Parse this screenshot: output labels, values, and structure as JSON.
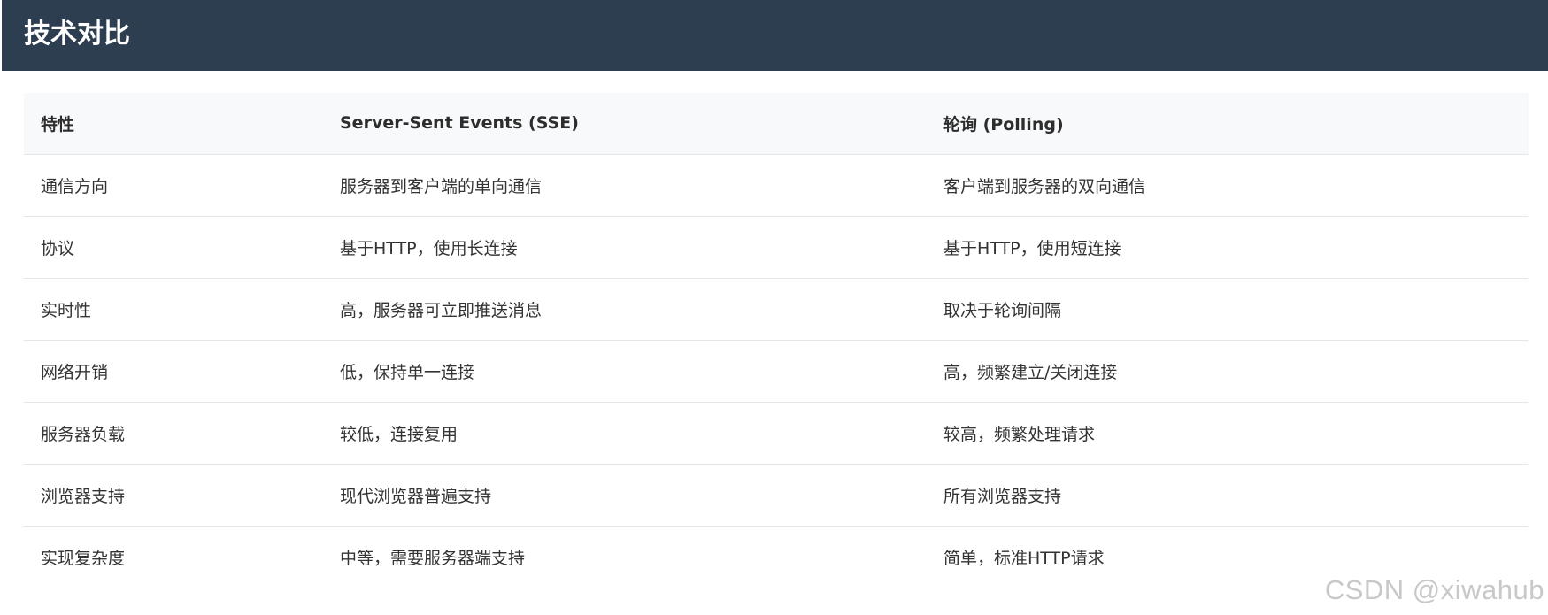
{
  "header": {
    "title": "技术对比"
  },
  "table": {
    "headers": [
      "特性",
      "Server-Sent Events (SSE)",
      "轮询 (Polling)"
    ],
    "rows": [
      [
        "通信方向",
        "服务器到客户端的单向通信",
        "客户端到服务器的双向通信"
      ],
      [
        "协议",
        "基于HTTP，使用长连接",
        "基于HTTP，使用短连接"
      ],
      [
        "实时性",
        "高，服务器可立即推送消息",
        "取决于轮询间隔"
      ],
      [
        "网络开销",
        "低，保持单一连接",
        "高，频繁建立/关闭连接"
      ],
      [
        "服务器负载",
        "较低，连接复用",
        "较高，频繁处理请求"
      ],
      [
        "浏览器支持",
        "现代浏览器普遍支持",
        "所有浏览器支持"
      ],
      [
        "实现复杂度",
        "中等，需要服务器端支持",
        "简单，标准HTTP请求"
      ]
    ]
  },
  "watermark": "CSDN @xiwahub",
  "colors": {
    "header_bg": "#2c3e50",
    "header_text": "#ffffff",
    "table_head_bg": "#f8f9fa",
    "row_border": "#e6e6e6"
  }
}
